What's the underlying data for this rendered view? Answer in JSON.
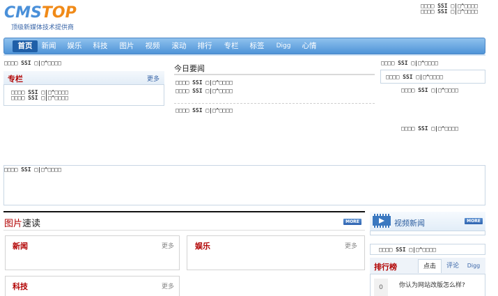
{
  "logo": {
    "brand_a": "CMS",
    "brand_b": "TOP",
    "tagline": "顶级新媒体技术提供商"
  },
  "ssi_text": "□□□□ SSI □|□^□□□□",
  "nav": {
    "items": [
      "首页",
      "新闻",
      "娱乐",
      "科技",
      "图片",
      "视频",
      "滚动",
      "排行",
      "专栏",
      "标签",
      "Digg",
      "心情"
    ]
  },
  "columns": {
    "title": "专栏",
    "more": "更多"
  },
  "today": {
    "title": "今日要闻"
  },
  "photo": {
    "title_a": "图片",
    "title_b": "速读",
    "more_badge": "MORE"
  },
  "sections": [
    {
      "title": "新闻",
      "more": "更多"
    },
    {
      "title": "娱乐",
      "more": "更多"
    },
    {
      "title": "科技",
      "more": "更多"
    }
  ],
  "video": {
    "title": "视频新闻",
    "more_badge": "MORE"
  },
  "rank": {
    "title": "排行榜",
    "tabs": [
      "点击",
      "评论",
      "Digg"
    ],
    "first_item": {
      "num": "0",
      "text": "你认为网站改版怎么样?"
    }
  },
  "colors": {
    "nav_bg": "#4f94d8",
    "accent_red": "#b10000",
    "logo_blue": "#4a90d9",
    "logo_orange": "#f08a18"
  },
  "icons": [
    "film-icon"
  ]
}
